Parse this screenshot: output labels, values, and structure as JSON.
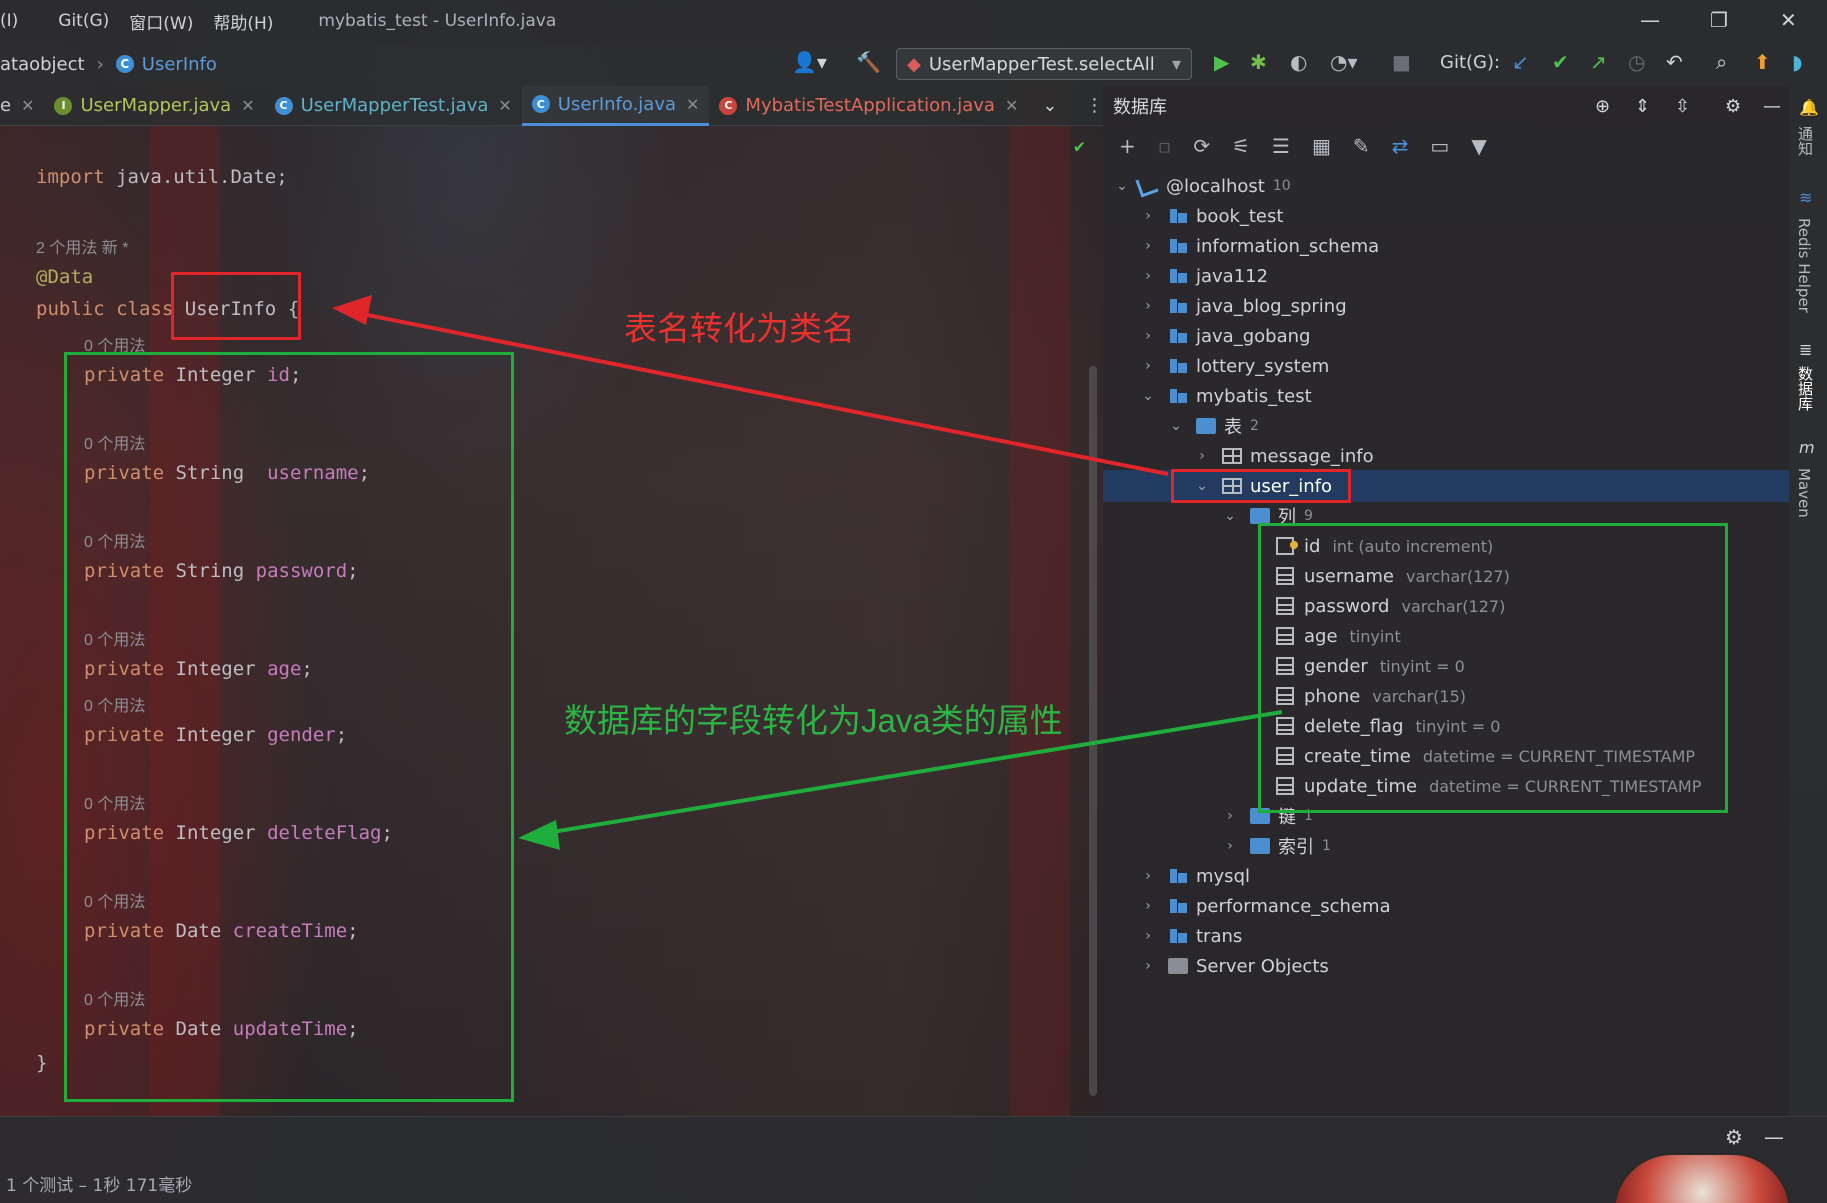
{
  "titlebar": {
    "menus": [
      "(I)",
      "Git(G)",
      "窗口(W)",
      "帮助(H)"
    ],
    "window_title": "mybatis_test - UserInfo.java"
  },
  "nav": {
    "crumb_prev": "ataobject",
    "crumb_current": "UserInfo",
    "run_config": "UserMapperTest.selectAll",
    "git_label": "Git(G):"
  },
  "tabs": [
    {
      "label": "e",
      "type": "partial"
    },
    {
      "label": "UserMapper.java",
      "type": "interface"
    },
    {
      "label": "UserMapperTest.java",
      "type": "class"
    },
    {
      "label": "UserInfo.java",
      "type": "class",
      "active": true
    },
    {
      "label": "MybatisTestApplication.java",
      "type": "class-red"
    }
  ],
  "code": {
    "import_kw": "import",
    "import_rest": " java.util.Date;",
    "usage_header": "2 个用法   新 *",
    "annotation": "@Data",
    "class_kw": "public class",
    "class_name": "UserInfo",
    "brace_open": " {",
    "brace_close": "}",
    "usage_hint": "0 个用法",
    "fields": [
      {
        "mod": "private",
        "type": "Integer",
        "name": "id"
      },
      {
        "mod": "private",
        "type": "String",
        "name": " username"
      },
      {
        "mod": "private",
        "type": "String",
        "name": "password"
      },
      {
        "mod": "private",
        "type": "Integer",
        "name": "age"
      },
      {
        "mod": "private",
        "type": "Integer",
        "name": "gender"
      },
      {
        "mod": "private",
        "type": "Integer",
        "name": "deleteFlag"
      },
      {
        "mod": "private",
        "type": "Date",
        "name": "createTime"
      },
      {
        "mod": "private",
        "type": "Date",
        "name": "updateTime"
      }
    ]
  },
  "db": {
    "title": "数据库",
    "host": "@localhost",
    "host_count": "10",
    "databases": [
      "book_test",
      "information_schema",
      "java112",
      "java_blog_spring",
      "java_gobang",
      "lottery_system",
      "mybatis_test"
    ],
    "tables_label": "表",
    "tables_count": "2",
    "table_message": "message_info",
    "table_user": "user_info",
    "columns_label": "列",
    "columns_count": "9",
    "columns": [
      {
        "name": "id",
        "type": "int (auto increment)"
      },
      {
        "name": "username",
        "type": "varchar(127)"
      },
      {
        "name": "password",
        "type": "varchar(127)"
      },
      {
        "name": "age",
        "type": "tinyint"
      },
      {
        "name": "gender",
        "type": "tinyint = 0"
      },
      {
        "name": "phone",
        "type": "varchar(15)"
      },
      {
        "name": "delete_flag",
        "type": "tinyint = 0"
      },
      {
        "name": "create_time",
        "type": "datetime = CURRENT_TIMESTAMP"
      },
      {
        "name": "update_time",
        "type": "datetime = CURRENT_TIMESTAMP"
      }
    ],
    "keys_label": "键",
    "keys_count": "1",
    "index_label": "索引",
    "index_count": "1",
    "more_databases": [
      "mysql",
      "performance_schema",
      "trans"
    ],
    "server_objects": "Server Objects"
  },
  "rightstrip": {
    "notify": "通知",
    "redis": "Redis Helper",
    "database": "数据库",
    "maven": "Maven"
  },
  "status": {
    "text": "1 个测试 – 1秒 171毫秒"
  },
  "annotations": {
    "red_note": "表名转化为类名",
    "green_note": "数据库的字段转化为Java类的属性"
  },
  "colors": {
    "red": "#e0262b",
    "green": "#1fae3c",
    "accent": "#4a8fd8"
  }
}
